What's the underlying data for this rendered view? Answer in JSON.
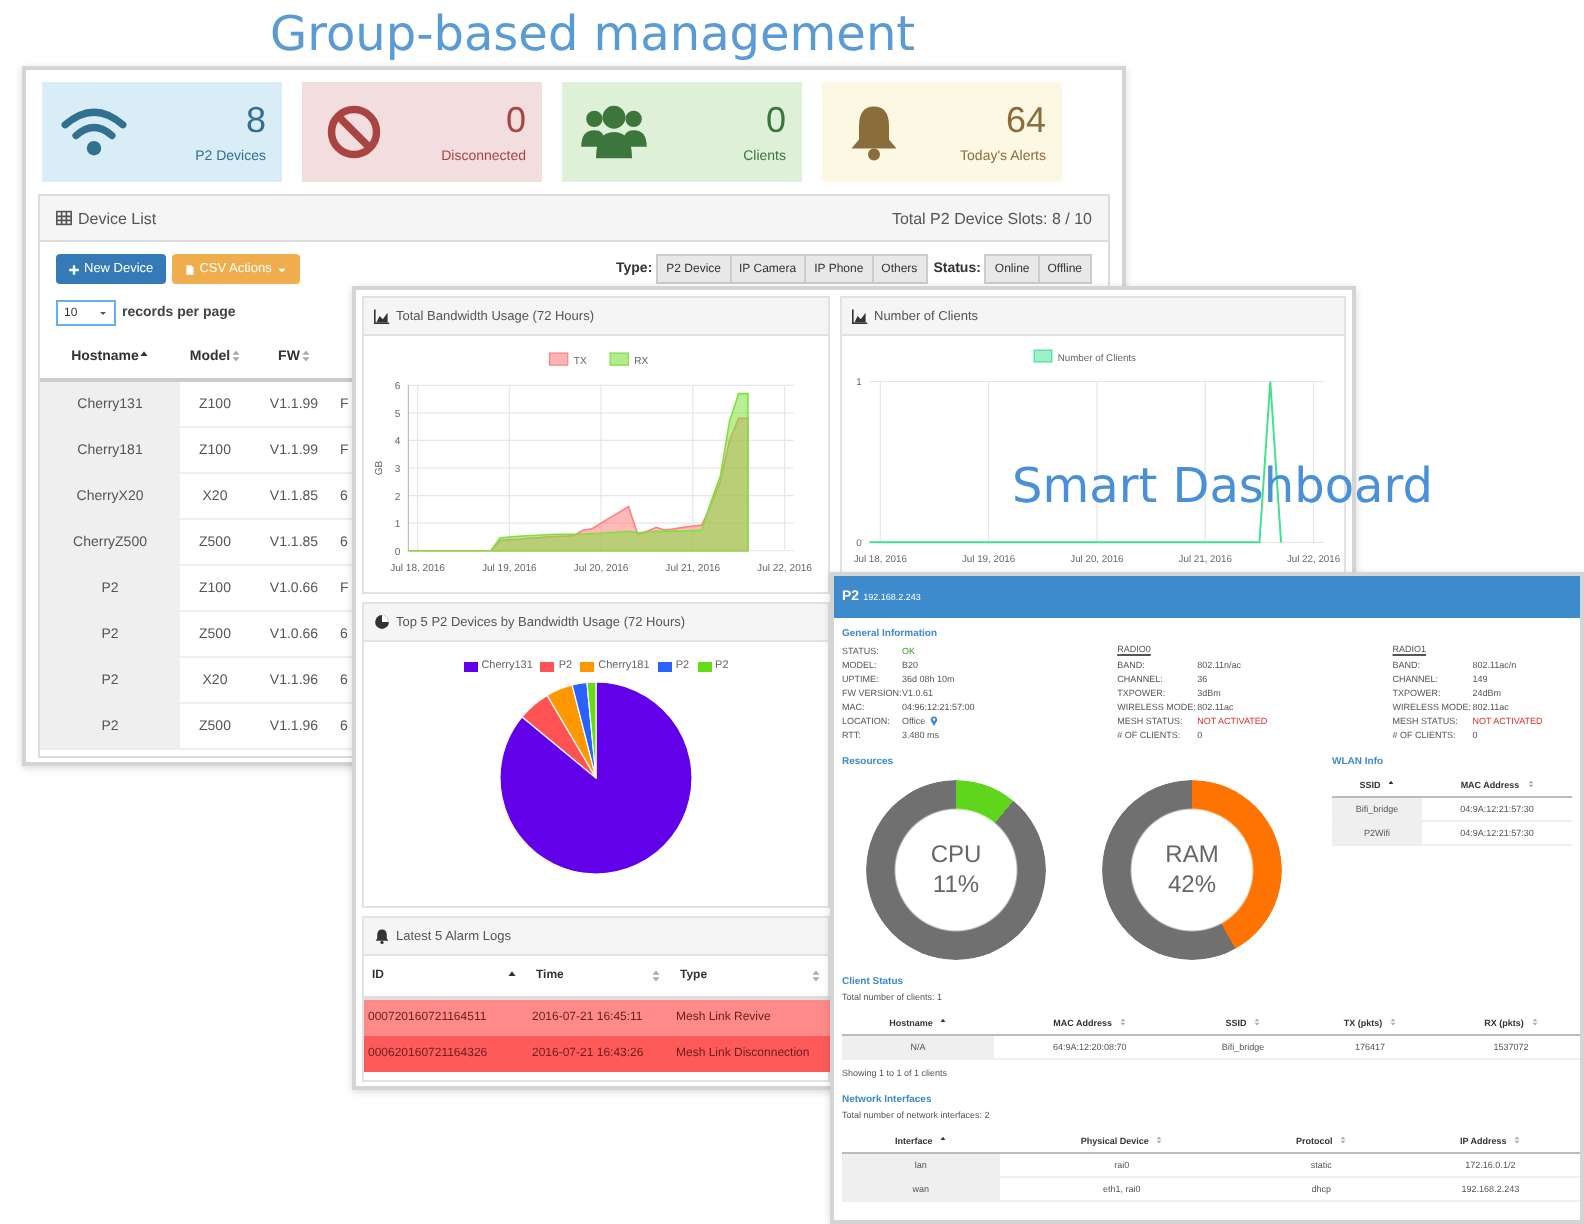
{
  "headline": "Group-based management",
  "overlay_title": "Smart Dashboard",
  "stats": [
    {
      "value": "8",
      "label": "P2 Devices",
      "kind": "wifi"
    },
    {
      "value": "0",
      "label": "Disconnected",
      "kind": "disconnected"
    },
    {
      "value": "0",
      "label": "Clients",
      "kind": "clients"
    },
    {
      "value": "64",
      "label": "Today's Alerts",
      "kind": "alerts"
    }
  ],
  "device_list": {
    "title": "Device List",
    "slots": "Total P2 Device Slots: 8 / 10",
    "buttons": [
      {
        "label": "New Device",
        "kind": "new"
      },
      {
        "label": "CSV Actions",
        "kind": "csv"
      }
    ],
    "type_label": "Type:",
    "types": [
      "P2 Device",
      "IP Camera",
      "IP Phone",
      "Others"
    ],
    "status_label": "Status:",
    "statuses": [
      "Online",
      "Offline"
    ],
    "page_size": "10",
    "page_size_label": "records per page",
    "columns": [
      {
        "label": "Hostname",
        "sorted": true
      },
      {
        "label": "Model",
        "sorted": false
      },
      {
        "label": "FW",
        "sorted": false
      }
    ],
    "rows": [
      [
        "Cherry131",
        "Z100",
        "V1.1.99",
        "F"
      ],
      [
        "Cherry181",
        "Z100",
        "V1.1.99",
        "F"
      ],
      [
        "CherryX20",
        "X20",
        "V1.1.85",
        "6"
      ],
      [
        "CherryZ500",
        "Z500",
        "V1.1.85",
        "6"
      ],
      [
        "P2",
        "Z100",
        "V1.0.66",
        "F"
      ],
      [
        "P2",
        "Z500",
        "V1.0.66",
        "6"
      ],
      [
        "P2",
        "X20",
        "V1.1.96",
        "6"
      ],
      [
        "P2",
        "Z500",
        "V1.1.96",
        "6"
      ]
    ]
  },
  "bandwidth": {
    "title": "Total Bandwidth Usage (72 Hours)",
    "chart_data": {
      "type": "area",
      "ylabel": "GB",
      "categories": [
        null,
        "Jul 18, 2016",
        null,
        null,
        null,
        null,
        null,
        null,
        null,
        null,
        null,
        "Jul 19, 2016",
        null,
        null,
        null,
        null,
        null,
        null,
        null,
        null,
        null,
        "Jul 20, 2016",
        null,
        null,
        null,
        null,
        null,
        null,
        null,
        null,
        null,
        "Jul 21, 2016",
        null,
        null,
        null,
        null,
        null,
        null,
        null,
        null,
        null,
        "Jul 22, 2016",
        null
      ],
      "series": [
        {
          "name": "TX",
          "color": "#ff8080",
          "values": [
            0,
            0,
            0,
            0,
            0,
            0,
            0,
            0,
            0,
            0,
            0.37,
            0.4,
            0.42,
            0.45,
            0.47,
            0.5,
            0.52,
            0.53,
            0.55,
            0.75,
            0.8,
            1.0,
            1.2,
            1.4,
            1.6,
            0.6,
            0.7,
            0.85,
            0.75,
            0.8,
            0.85,
            0.9,
            0.93,
            1.7,
            2.5,
            4.0,
            4.8,
            4.8,
            null,
            null,
            null,
            null,
            null
          ]
        },
        {
          "name": "RX",
          "color": "#80e040",
          "values": [
            0,
            0,
            0,
            0,
            0,
            0,
            0,
            0,
            0,
            0,
            0.47,
            0.5,
            0.52,
            0.54,
            0.56,
            0.58,
            0.6,
            0.6,
            0.6,
            0.6,
            0.62,
            0.64,
            0.66,
            0.68,
            0.7,
            0.65,
            0.67,
            0.7,
            0.7,
            0.71,
            0.72,
            0.73,
            0.75,
            1.8,
            2.7,
            4.7,
            5.7,
            5.7,
            null,
            null,
            null,
            null,
            null
          ]
        }
      ],
      "ylim": [
        0,
        6
      ],
      "grid": true,
      "legend": "top",
      "yticks": [
        0,
        1,
        2,
        3,
        4,
        5,
        6
      ]
    }
  },
  "clients_chart": {
    "title": "Number of Clients",
    "chart_data": {
      "type": "line",
      "categories": [
        null,
        "Jul 18, 2016",
        null,
        null,
        null,
        null,
        null,
        null,
        null,
        null,
        null,
        "Jul 19, 2016",
        null,
        null,
        null,
        null,
        null,
        null,
        null,
        null,
        null,
        "Jul 20, 2016",
        null,
        null,
        null,
        null,
        null,
        null,
        null,
        null,
        null,
        "Jul 21, 2016",
        null,
        null,
        null,
        null,
        null,
        null,
        null,
        null,
        null,
        "Jul 22, 2016",
        null
      ],
      "series": [
        {
          "name": "Number of Clients",
          "color": "#40e090",
          "values": [
            0,
            0,
            0,
            0,
            0,
            0,
            0,
            0,
            0,
            0,
            0,
            0,
            0,
            0,
            0,
            0,
            0,
            0,
            0,
            0,
            0,
            0,
            0,
            0,
            0,
            0,
            0,
            0,
            0,
            0,
            0,
            0,
            0,
            0,
            0,
            0,
            0,
            1,
            0,
            null,
            null,
            null,
            null
          ]
        }
      ],
      "ylim": [
        0,
        1
      ],
      "grid": true,
      "legend": "top",
      "yticks": [
        0,
        1
      ]
    }
  },
  "top_devices": {
    "title": "Top 5 P2 Devices by Bandwidth Usage (72 Hours)",
    "legend": [
      {
        "name": "Cherry131",
        "color": "#6200ea"
      },
      {
        "name": "P2",
        "color": "#ff5252"
      },
      {
        "name": "Cherry181",
        "color": "#ff9800"
      },
      {
        "name": "P2",
        "color": "#2962ff"
      },
      {
        "name": "P2",
        "color": "#64dd17"
      }
    ]
  },
  "alarms": {
    "title": "Latest 5 Alarm Logs",
    "columns": [
      {
        "label": "ID",
        "sorted": true
      },
      {
        "label": "Time",
        "sorted": false
      },
      {
        "label": "Type",
        "sorted": false
      }
    ],
    "rows": [
      {
        "cells": [
          "000720160721164511",
          "2016-07-21 16:45:11",
          "Mesh Link Revive"
        ],
        "color": "#ff8a8a"
      },
      {
        "cells": [
          "000620160721164326",
          "2016-07-21 16:43:26",
          "Mesh Link Disconnection"
        ],
        "color": "#ff5a5a"
      }
    ]
  },
  "device": {
    "name": "P2",
    "ip": "192.168.2.243",
    "general_title": "General Information",
    "general": [
      {
        "label": "STATUS:",
        "value": "OK",
        "kind": "ok"
      },
      {
        "label": "MODEL:",
        "value": "B20",
        "kind": "plain"
      },
      {
        "label": "UPTIME:",
        "value": "36d 08h 10m",
        "kind": "plain"
      },
      {
        "label": "FW VERSION:",
        "value": "V1.0.61",
        "kind": "plain"
      },
      {
        "label": "MAC:",
        "value": "04:96:12:21:57:00",
        "kind": "plain"
      },
      {
        "label": "LOCATION:",
        "value": "Office",
        "kind": "location"
      },
      {
        "label": "RTT:",
        "value": "3.480 ms",
        "kind": "plain"
      }
    ],
    "radios": [
      {
        "title": "RADIO0",
        "fields": [
          {
            "label": "BAND:",
            "value": "802.11n/ac",
            "kind": "plain"
          },
          {
            "label": "CHANNEL:",
            "value": "36",
            "kind": "plain"
          },
          {
            "label": "TXPOWER:",
            "value": "3dBm",
            "kind": "plain"
          },
          {
            "label": "WIRELESS MODE:",
            "value": "802.11ac",
            "kind": "plain"
          },
          {
            "label": "MESH STATUS:",
            "value": "NOT ACTIVATED",
            "kind": "alert"
          },
          {
            "label": "# OF CLIENTS:",
            "value": "0",
            "kind": "plain"
          }
        ]
      },
      {
        "title": "RADIO1",
        "fields": [
          {
            "label": "BAND:",
            "value": "802.11ac/n",
            "kind": "plain"
          },
          {
            "label": "CHANNEL:",
            "value": "149",
            "kind": "plain"
          },
          {
            "label": "TXPOWER:",
            "value": "24dBm",
            "kind": "plain"
          },
          {
            "label": "WIRELESS MODE:",
            "value": "802.11ac",
            "kind": "plain"
          },
          {
            "label": "MESH STATUS:",
            "value": "NOT ACTIVATED",
            "kind": "alert"
          },
          {
            "label": "# OF CLIENTS:",
            "value": "0",
            "kind": "plain"
          }
        ]
      }
    ],
    "resources_title": "Resources",
    "meters": [
      {
        "label": "CPU",
        "reading": "11%",
        "level": 0.11,
        "color": "#5fd51b"
      },
      {
        "label": "RAM",
        "reading": "42%",
        "level": 0.42,
        "color": "#ff7300"
      }
    ],
    "wlan": {
      "title": "WLAN Info",
      "columns": [
        {
          "label": "SSID",
          "sorted": true
        },
        {
          "label": "MAC Address",
          "sorted": false
        }
      ],
      "rows": [
        [
          "Bifi_bridge",
          "04:9A:12:21:57:30"
        ],
        [
          "P2Wifi",
          "04:9A:12:21:57:30"
        ]
      ]
    },
    "clients": {
      "title": "Client Status",
      "summary": "Total number of clients: 1",
      "columns": [
        {
          "label": "Hostname",
          "sorted": true
        },
        {
          "label": "MAC Address",
          "sorted": false
        },
        {
          "label": "SSID",
          "sorted": false
        },
        {
          "label": "TX (pkts)",
          "sorted": false
        },
        {
          "label": "RX (pkts)",
          "sorted": false
        }
      ],
      "rows": [
        [
          "N/A",
          "64:9A:12:20:08:70",
          "Bifi_bridge",
          "176417",
          "1537072"
        ]
      ],
      "footer": "Showing 1 to 1 of 1 clients"
    },
    "interfaces": {
      "title": "Network Interfaces",
      "summary": "Total number of network interfaces: 2",
      "columns": [
        {
          "label": "Interface",
          "sorted": true
        },
        {
          "label": "Physical Device",
          "sorted": false
        },
        {
          "label": "Protocol",
          "sorted": false
        },
        {
          "label": "IP Address",
          "sorted": false
        }
      ],
      "rows": [
        [
          "lan",
          "rai0",
          "static",
          "172.16.0.1/2"
        ],
        [
          "wan",
          "eth1, rai0",
          "dhcp",
          "192.168.2.243"
        ]
      ]
    }
  }
}
